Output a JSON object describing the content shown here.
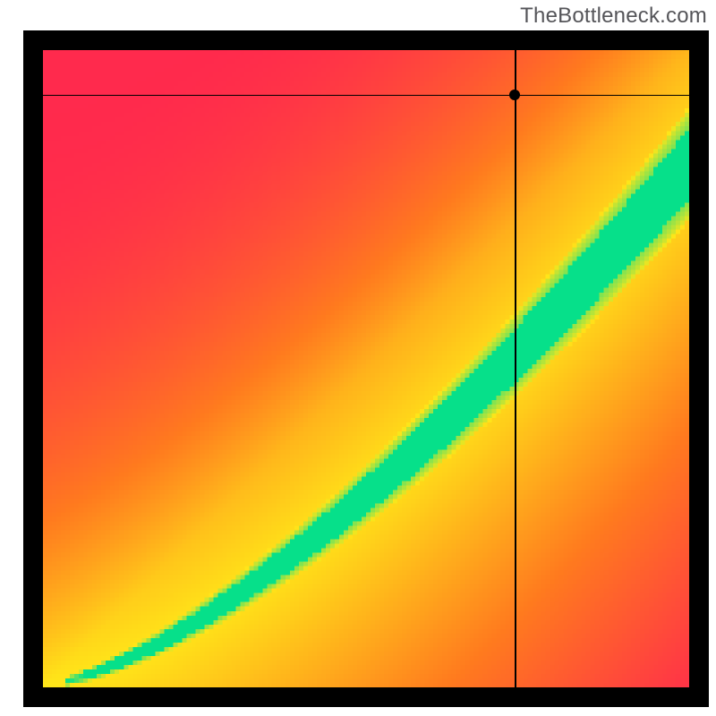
{
  "watermark": "TheBottleneck.com",
  "chart_data": {
    "type": "heatmap",
    "title": "",
    "xlabel": "",
    "ylabel": "",
    "xlim": [
      0,
      100
    ],
    "ylim": [
      0,
      100
    ],
    "green_corridor": {
      "description": "Optimal match band — center slope and half-width as fraction of range",
      "start": {
        "x": 0,
        "y_center": 0,
        "half_width": 0.5
      },
      "end": {
        "x": 100,
        "y_center": 82,
        "half_width": 9
      },
      "curve_power": 1.45
    },
    "crosshair": {
      "x": 73,
      "y": 93
    },
    "marker": {
      "x": 73,
      "y": 93
    },
    "color_stops": {
      "red": "#ff2a4d",
      "orange": "#ff7a1f",
      "yellow": "#ffe619",
      "green": "#06e08a"
    },
    "pixelation": 5
  }
}
